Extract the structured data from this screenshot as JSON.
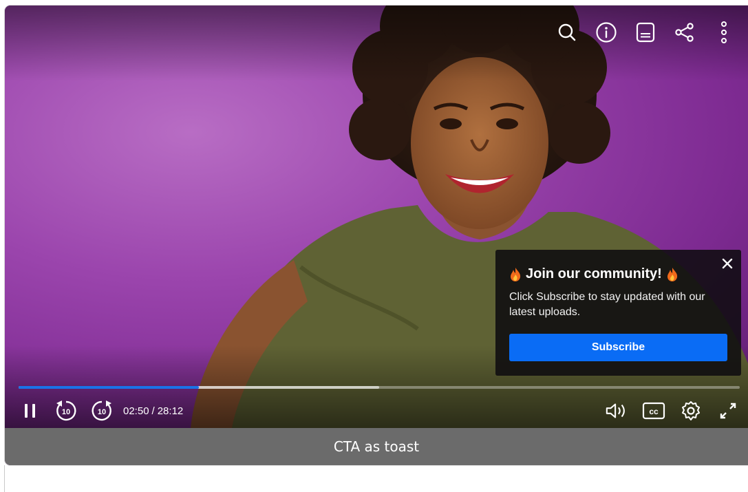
{
  "player": {
    "top_icons": [
      "search-icon",
      "info-icon",
      "transcript-icon",
      "share-icon",
      "more-vertical-icon"
    ],
    "progress": {
      "played_fraction": 0.25,
      "buffered_fraction": 0.5,
      "accent_color": "#1a73e8"
    },
    "time": {
      "current": "02:50",
      "separator": "/",
      "duration": "28:12"
    },
    "bottom_icons": [
      "pause-icon",
      "rewind-10-icon",
      "forward-10-icon",
      "volume-icon",
      "closed-captions-icon",
      "settings-icon",
      "fullscreen-icon"
    ]
  },
  "toast": {
    "title": "Join our community!",
    "title_icon": "flame-icon",
    "body": "Click Subscribe to stay updated with our latest uploads.",
    "button_label": "Subscribe",
    "button_color": "#0a6cf5",
    "close_icon": "close-icon"
  },
  "caption": {
    "text": "CTA as toast"
  }
}
